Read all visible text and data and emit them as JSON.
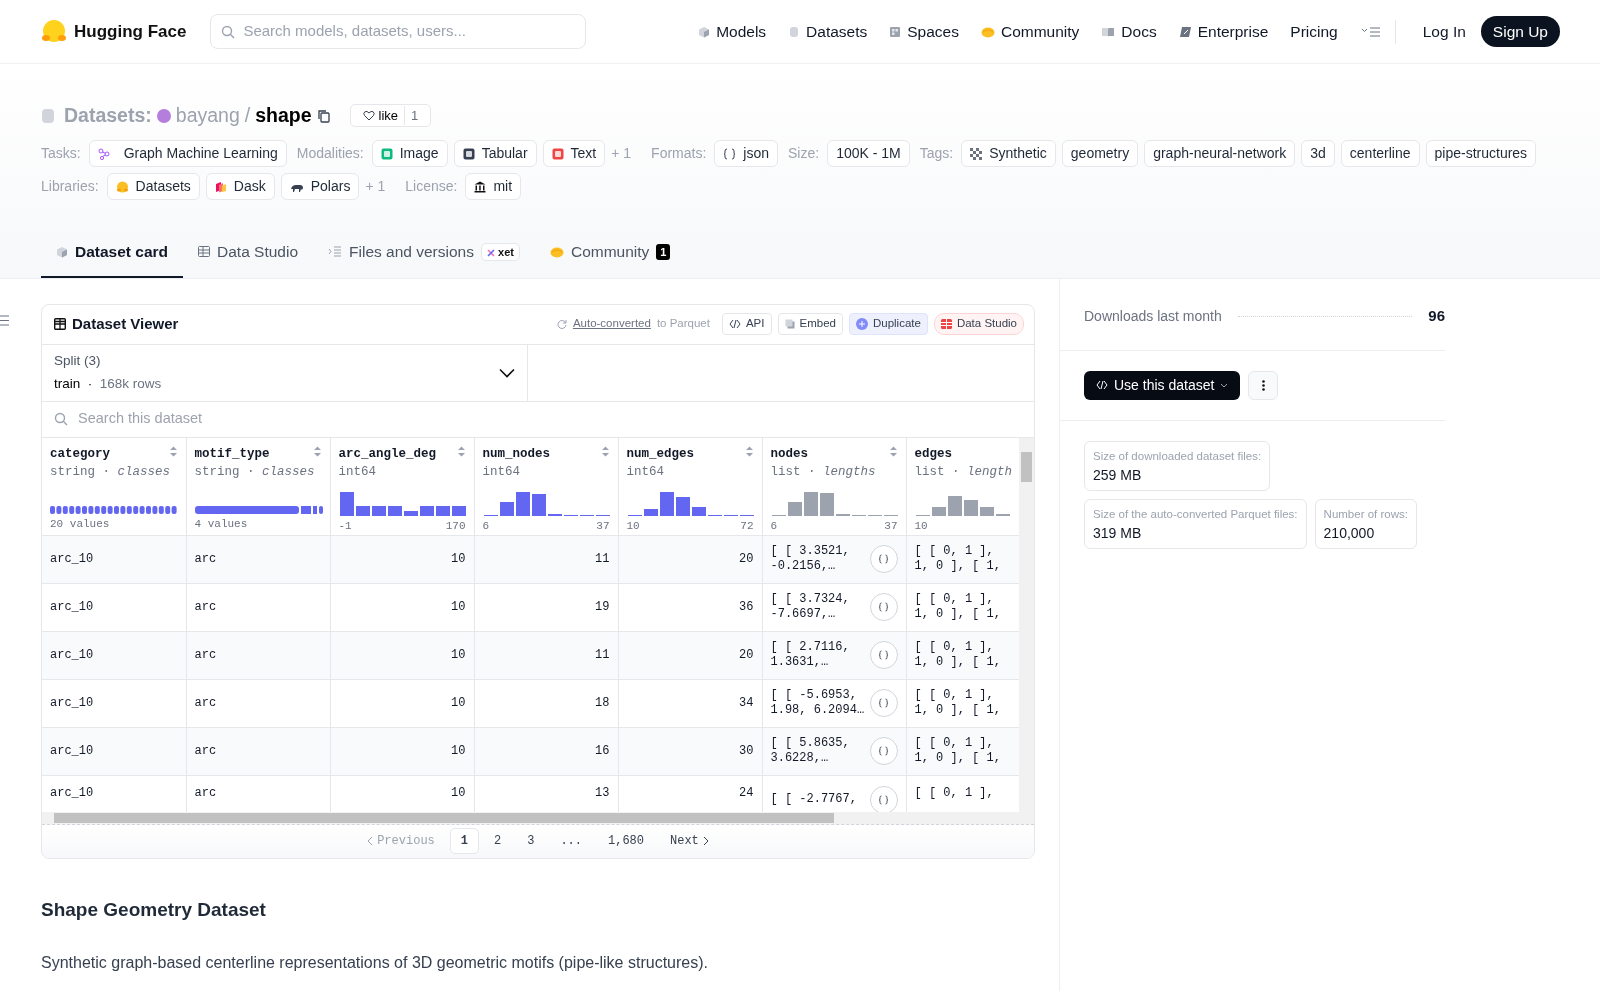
{
  "navbar": {
    "brand": "Hugging Face",
    "search": {
      "placeholder": "Search models, datasets, users..."
    },
    "links": [
      {
        "label": "Models"
      },
      {
        "label": "Datasets"
      },
      {
        "label": "Spaces"
      },
      {
        "label": "Community"
      },
      {
        "label": "Docs"
      },
      {
        "label": "Enterprise"
      },
      {
        "label": "Pricing"
      }
    ],
    "login": "Log In",
    "signup": "Sign Up"
  },
  "header": {
    "prefix": "Datasets:",
    "owner": "bayang",
    "separator": "/",
    "name": "shape",
    "like": {
      "label": "like",
      "count": "1"
    }
  },
  "tag_rows": [
    [
      {
        "label": "Tasks:",
        "items": [
          "Graph Machine Learning"
        ]
      },
      {
        "label": "Modalities:",
        "items": [
          "Image",
          "Tabular",
          "Text"
        ],
        "more": "+ 1"
      },
      {
        "label": "Formats:",
        "items": [
          "json"
        ]
      },
      {
        "label": "Size:",
        "items": [
          "100K - 1M"
        ]
      },
      {
        "label": "Tags:",
        "items": [
          "Synthetic",
          "geometry",
          "graph-neural-network",
          "3d",
          "centerline",
          "pipe-structures"
        ]
      }
    ],
    [
      {
        "label": "Libraries:",
        "items": [
          "Datasets",
          "Dask",
          "Polars"
        ],
        "more": "+ 1"
      },
      {
        "label": "License:",
        "items": [
          "mit"
        ]
      }
    ]
  ],
  "tabs": [
    {
      "label": "Dataset card",
      "selected": true
    },
    {
      "label": "Data Studio",
      "selected": false
    },
    {
      "label": "Files and versions",
      "selected": false,
      "badge": "xet"
    },
    {
      "label": "Community",
      "selected": false,
      "badge": "1"
    }
  ],
  "viewer": {
    "title": "Dataset Viewer",
    "converted_link": "Auto-converted",
    "converted_rest": "to Parquet",
    "buttons": [
      {
        "label": "API",
        "kind": "plain"
      },
      {
        "label": "Embed",
        "kind": "plain"
      },
      {
        "label": "Duplicate",
        "kind": "accent"
      },
      {
        "label": "Data Studio",
        "kind": "studio"
      }
    ],
    "split": {
      "label": "Split (3)",
      "value": "train",
      "separator": "·",
      "rows": "168k rows"
    },
    "search": {
      "placeholder": "Search this dataset"
    },
    "columns": [
      {
        "name": "category",
        "type": "string · *classes*",
        "kind": "classes",
        "min": "20 values"
      },
      {
        "name": "motif_type",
        "type": "string · *classes*",
        "kind": "classes",
        "min": "4 values"
      },
      {
        "name": "arc_angle_deg",
        "type": "int64",
        "kind": "numeric",
        "min": "-1",
        "max": "170"
      },
      {
        "name": "num_nodes",
        "type": "int64",
        "kind": "numeric",
        "min": "6",
        "max": "37"
      },
      {
        "name": "num_edges",
        "type": "int64",
        "kind": "numeric",
        "min": "10",
        "max": "72"
      },
      {
        "name": "nodes",
        "type": "list · *lengths*",
        "kind": "list",
        "min": "6",
        "max": "37"
      },
      {
        "name": "edges",
        "type": "list · *length*",
        "kind": "list",
        "min": "10"
      }
    ],
    "rows": [
      [
        "arc_10",
        "arc",
        "10",
        "11",
        "20",
        "[ [ 3.3521,\n-0.2156,…",
        "[ [ 0, 1 ],\n1, 0 ], [ 1,"
      ],
      [
        "arc_10",
        "arc",
        "10",
        "19",
        "36",
        "[ [ 3.7324,\n-7.6697,…",
        "[ [ 0, 1 ],\n1, 0 ], [ 1,"
      ],
      [
        "arc_10",
        "arc",
        "10",
        "11",
        "20",
        "[ [ 2.7116,\n1.3631,…",
        "[ [ 0, 1 ],\n1, 0 ], [ 1,"
      ],
      [
        "arc_10",
        "arc",
        "10",
        "18",
        "34",
        "[ [ -5.6953,\n1.98, 6.2094…",
        "[ [ 0, 1 ],\n1, 0 ], [ 1,"
      ],
      [
        "arc_10",
        "arc",
        "10",
        "16",
        "30",
        "[ [ 5.8635,\n3.6228,…",
        "[ [ 0, 1 ],\n1, 0 ], [ 1,"
      ],
      [
        "arc_10",
        "arc",
        "10",
        "13",
        "24",
        "[ [ -2.7767,",
        "[ [ 0, 1 ],"
      ]
    ],
    "pagination": [
      {
        "label": "Previous",
        "kind": "prev",
        "disabled": true
      },
      {
        "label": "1",
        "kind": "page",
        "selected": true
      },
      {
        "label": "2",
        "kind": "page",
        "selected": false
      },
      {
        "label": "3",
        "kind": "page",
        "selected": false
      },
      {
        "label": "...",
        "kind": "gap"
      },
      {
        "label": "1,680",
        "kind": "page",
        "selected": false
      },
      {
        "label": "Next",
        "kind": "next",
        "disabled": false
      }
    ]
  },
  "readme": {
    "title": "Shape Geometry Dataset",
    "text": "Synthetic graph-based centerline representations of 3D geometric motifs (pipe-like structures)."
  },
  "sidebar": {
    "downloads_label": "Downloads last month",
    "downloads": "96",
    "use_button": "Use this dataset",
    "stats": [
      [
        {
          "label": "Size of downloaded dataset files:",
          "value": "259 MB"
        }
      ],
      [
        {
          "label": "Size of the auto-converted Parquet files:",
          "value": "319 MB"
        },
        {
          "label": "Number of rows:",
          "value": "210,000"
        }
      ]
    ]
  }
}
